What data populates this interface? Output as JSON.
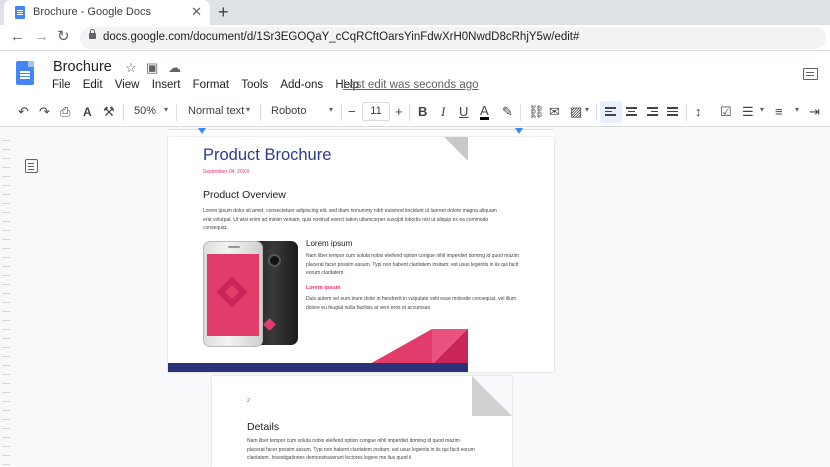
{
  "browser": {
    "tab_title": "Brochure - Google Docs",
    "tab_close": "✕",
    "new_tab": "+",
    "back": "←",
    "forward": "→",
    "reload": "↻",
    "url": "docs.google.com/document/d/1Sr3EGOQaY_cCqRCftOarsYinFdwXrH0NwdD8cRhjY5w/edit#"
  },
  "docs": {
    "title": "Brochure",
    "star": "☆",
    "move": "▣",
    "cloud": "☁",
    "menus": [
      "File",
      "Edit",
      "View",
      "Insert",
      "Format",
      "Tools",
      "Add-ons",
      "Help"
    ],
    "last_edit": "Last edit was seconds ago"
  },
  "toolbar": {
    "undo": "↶",
    "redo": "↷",
    "print": "⎙",
    "spellcheck": "A",
    "paint": "⚒",
    "zoom": "50%",
    "style": "Normal text",
    "font": "Roboto",
    "minus": "−",
    "font_size": "11",
    "plus": "+",
    "bold": "B",
    "italic": "I",
    "underline": "U",
    "text_color": "A",
    "highlight": "✎",
    "link": "⛓",
    "comment": "✉",
    "image": "▨",
    "line_spacing": "↕",
    "checklist": "☑",
    "bullets": "☰",
    "numbered": "≡",
    "indent": "⇥",
    "caret": "▾"
  },
  "page1": {
    "title": "Product Brochure",
    "date": "September 04, 20XX",
    "heading": "Product Overview",
    "overview_text": "Lorem ipsum dolor sit amet, consectetuer adipiscing elit, sed diam nonummy nibh euismod tincidunt ut laoreet dolore magna aliquam erat volutpat. Ut wisi enim ad minim veniam, quis nostrud exerci tation ullamcorper suscipit lobortis nisl ut aliquip ex ea commodo consequat.",
    "subhead": "Lorem ipsum",
    "sub_text": "Nam liber tempor cum soluta nobis eleifend option congue nihil imperdiet doming id quod mazim placerat facer possim assum. Typi non habent claritatem insitam; est usus legentis in iis qui facit eorum claritatem.",
    "pink_head": "Lorem ipsum",
    "pink_text": "Duis autem vel eum iriure dolor in hendrerit in vulputate velit esse molestie consequat, vel illum dolore eu feugiat nulla facilisis at vero eros et accumsan."
  },
  "page2": {
    "page_number": "2",
    "heading": "Details",
    "text": "Nam liber tempor cum soluta nobis eleifend option congue nihil imperdiet doming id quod mazim placerat facer possim assum. Typi non habent claritatem insitam; est usus legentis in iis qui facit eorum claritatem. Investigationes demonstraverunt lectores legere me lius quod ii"
  },
  "colors": {
    "brand_blue": "#4285f4",
    "title_navy": "#2b3d8f",
    "accent_pink": "#e8336f",
    "band_navy": "#2a3279"
  }
}
